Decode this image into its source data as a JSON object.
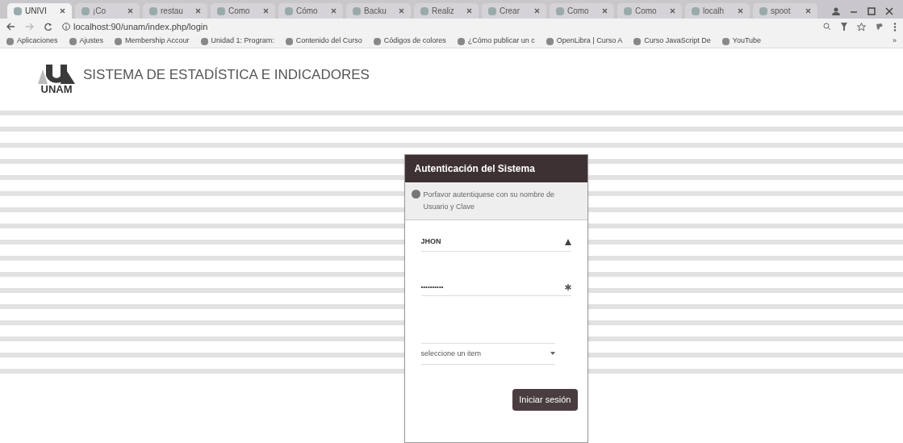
{
  "browser": {
    "tabs": [
      {
        "label": "UNIVI",
        "selected": true
      },
      {
        "label": "¡Co",
        "selected": false
      },
      {
        "label": "restau",
        "selected": false
      },
      {
        "label": "Como",
        "selected": false
      },
      {
        "label": "Cómo",
        "selected": false
      },
      {
        "label": "Backu",
        "selected": false
      },
      {
        "label": "Realiz",
        "selected": false
      },
      {
        "label": "Crear",
        "selected": false
      },
      {
        "label": "Como",
        "selected": false
      },
      {
        "label": "Como",
        "selected": false
      },
      {
        "label": "localh",
        "selected": false
      },
      {
        "label": "spoot",
        "selected": false
      }
    ],
    "url": "localhost:90/unam/index.php/login",
    "bookmarks": [
      "Aplicaciones",
      "Ajustes",
      "Membership Accour",
      "Unidad 1: Program:",
      "Contenido del Curso",
      "Códigos de colores",
      "¿Cómo publicar un c",
      "OpenLibra | Curso A",
      "Curso JavaScript De",
      "YouTube"
    ],
    "bookmarks_more": "»"
  },
  "header": {
    "logo_text": "UNAM",
    "title": "SISTEMA DE ESTADÍSTICA E INDICADORES"
  },
  "login": {
    "title": "Autenticación del Sistema",
    "info": "Porfavor autentiquese con su nombre de Usuario y Clave",
    "username": "JHON",
    "password": "••••••••••",
    "select_placeholder": "seleccione un item",
    "submit": "Iniciar sesión"
  }
}
